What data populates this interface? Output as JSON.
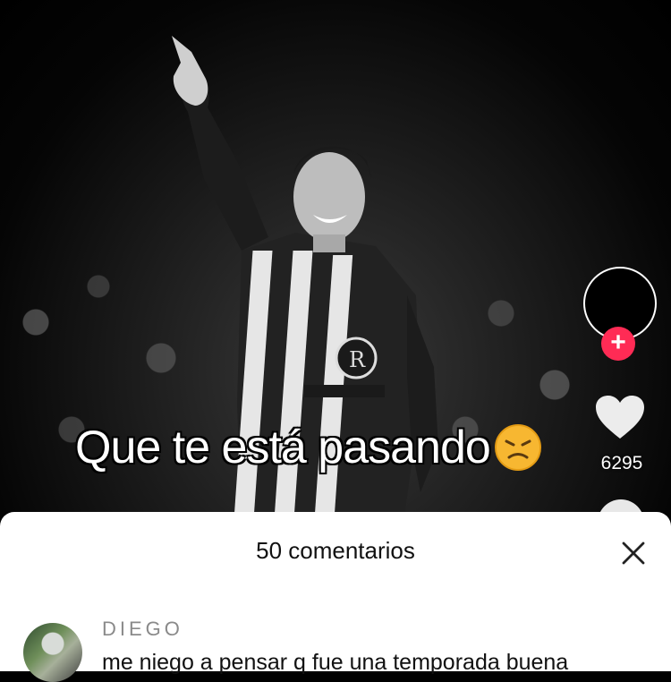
{
  "video": {
    "caption": "Que te está pasando",
    "caption_emoji": "disappointed-face-emoji"
  },
  "rail": {
    "follow_label": "+",
    "like_count": "6295",
    "accent_color": "#ff2b55"
  },
  "comments_sheet": {
    "title": "50 comentarios",
    "close_icon": "close-icon",
    "comments": [
      {
        "username": "DIEGO",
        "text": "me niego a pensar q fue una temporada buena"
      }
    ]
  }
}
